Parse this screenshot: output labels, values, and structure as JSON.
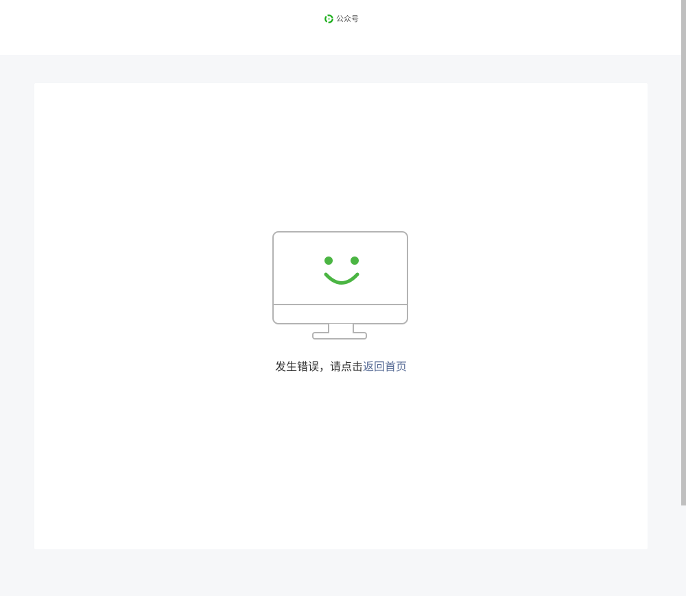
{
  "header": {
    "brand_name": "公众号",
    "logo_icon": "wechat-official-accounts-logo-icon",
    "logo_color": "#1aad19"
  },
  "error": {
    "illustration_icon": "smiling-monitor-icon",
    "accent_color": "#4bb543",
    "outline_color": "#b3b3b3",
    "message_text": "发生错误，请点击",
    "link_text": "返回首页",
    "link_color": "#576b95"
  }
}
